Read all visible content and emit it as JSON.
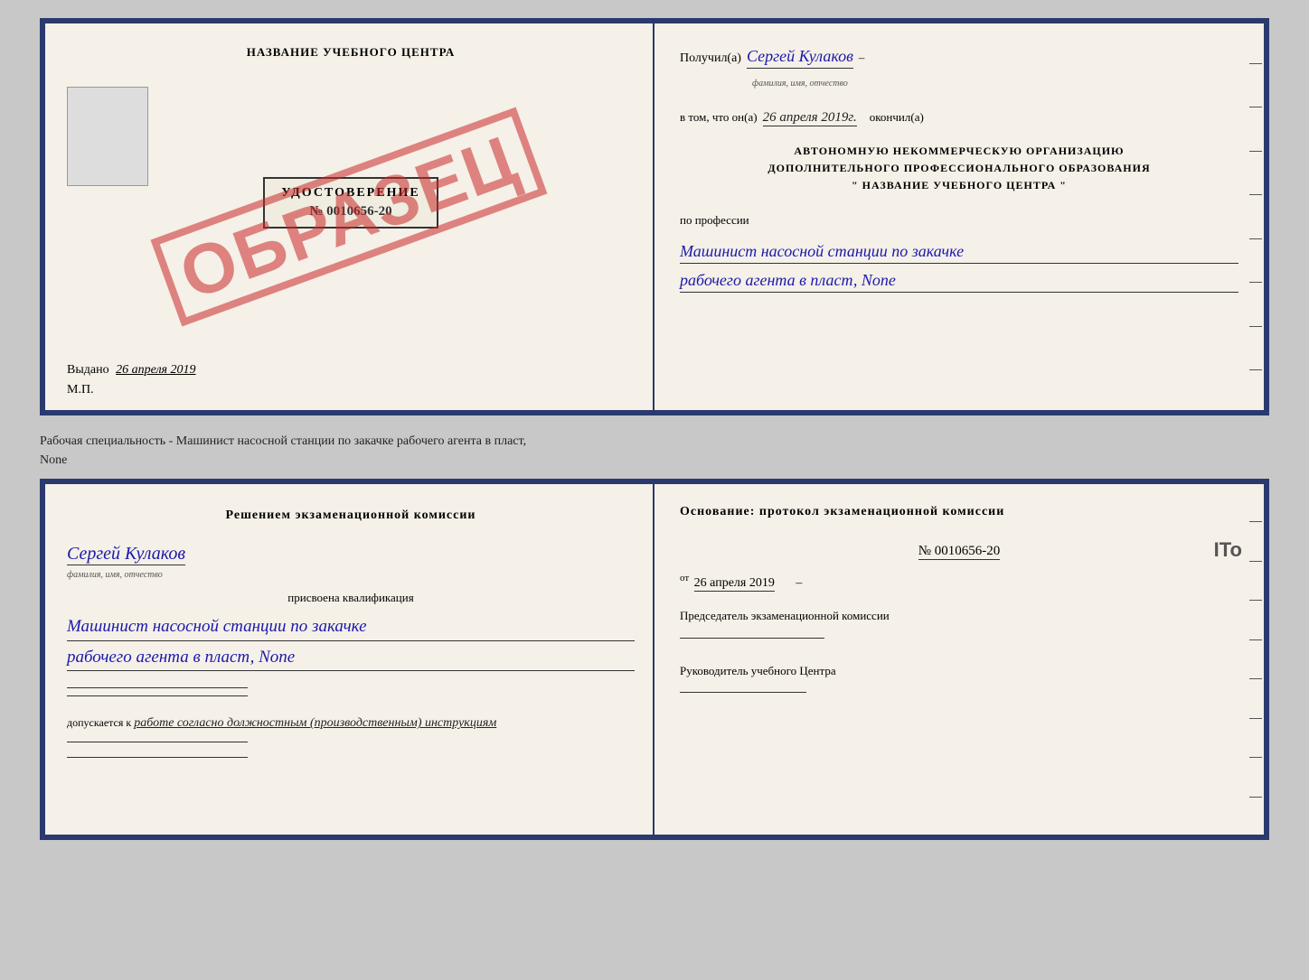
{
  "top_cert": {
    "left": {
      "center_title": "НАЗВАНИЕ УЧЕБНОГО ЦЕНТРА",
      "stamp": "ОБРАЗЕЦ",
      "udostoverenie": "УДОСТОВЕРЕНИЕ",
      "number": "№ 0010656-20",
      "vydano_label": "Выдано",
      "vydano_date": "26 апреля 2019",
      "mp_label": "М.П."
    },
    "right": {
      "poluchil_label": "Получил(а)",
      "poluchil_value": "Сергей Кулаков",
      "fio_label": "фамилия, имя, отчество",
      "dash": "–",
      "vtom_label": "в том, что он(а)",
      "date_value": "26 апреля 2019г.",
      "okonchil_label": "окончил(а)",
      "org_line1": "АВТОНОМНУЮ НЕКОММЕРЧЕСКУЮ ОРГАНИЗАЦИЮ",
      "org_line2": "ДОПОЛНИТЕЛЬНОГО ПРОФЕССИОНАЛЬНОГО ОБРАЗОВАНИЯ",
      "org_line3": "\"  НАЗВАНИЕ УЧЕБНОГО ЦЕНТРА  \"",
      "po_professii": "по профессии",
      "prof_line1": "Машинист насосной станции по закачке",
      "prof_line2": "рабочего агента в пласт, None"
    }
  },
  "description": {
    "line1": "Рабочая специальность - Машинист насосной станции по закачке рабочего агента в пласт,",
    "line2": "None"
  },
  "bottom_cert": {
    "left": {
      "resheniem_text": "Решением  экзаменационной  комиссии",
      "person_value": "Сергей Кулаков",
      "fio_label": "фамилия, имя, отчество",
      "prisvoena": "присвоена квалификация",
      "kvali_line1": "Машинист насосной станции по закачке",
      "kvali_line2": "рабочего агента в пласт, None",
      "dopusk_label": "допускается к",
      "dopusk_value": "работе согласно должностным (производственным) инструкциям"
    },
    "right": {
      "osnov_text": "Основание: протокол экзаменационной  комиссии",
      "protocol_number": "№  0010656-20",
      "ot_label": "от",
      "ot_date": "26 апреля 2019",
      "chairman_label": "Председатель экзаменационной комиссии",
      "rukov_label": "Руководитель учебного Центра"
    }
  },
  "ito_text": "ITo"
}
